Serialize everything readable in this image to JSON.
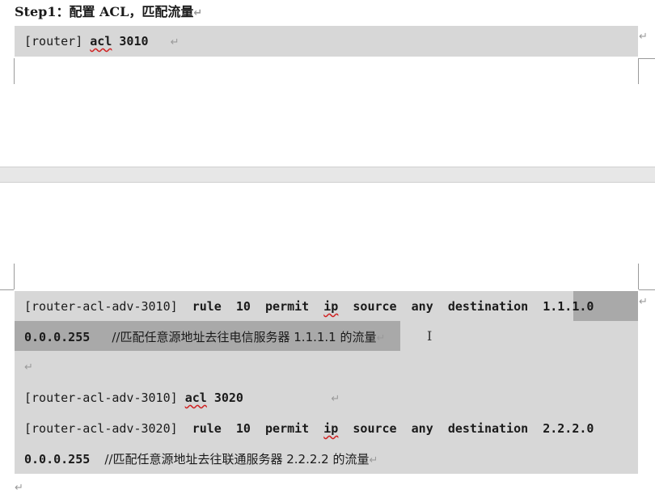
{
  "heading": {
    "text": "Step1：配置 ACL，匹配流量"
  },
  "para_mark": "↵",
  "code1": {
    "prompt": "[router]",
    "cmd": "acl",
    "num": "3010"
  },
  "code2": {
    "l1_prompt": "[router-acl-adv-3010]",
    "l1_rule": "rule",
    "l1_10": "10",
    "l1_permit": "permit",
    "l1_ip": "ip",
    "l1_source": "source",
    "l1_any": "any",
    "l1_destination": "destination",
    "l1_addr": "1.1.1.0",
    "l2_mask": "0.0.0.255",
    "l2_comment": "//匹配任意源地址去往电信服务器 1.1.1.1 的流量",
    "l4_prompt": "[router-acl-adv-3010]",
    "l4_cmd": "acl",
    "l4_num": "3020",
    "l5_prompt": "[router-acl-adv-3020]",
    "l5_rule": "rule",
    "l5_10": "10",
    "l5_permit": "permit",
    "l5_ip": "ip",
    "l5_source": "source",
    "l5_any": "any",
    "l5_destination": "destination",
    "l5_addr": "2.2.2.0",
    "l6_mask": "0.0.0.255",
    "l6_comment": "//匹配任意源地址去往联通服务器 2.2.2.2 的流量"
  }
}
